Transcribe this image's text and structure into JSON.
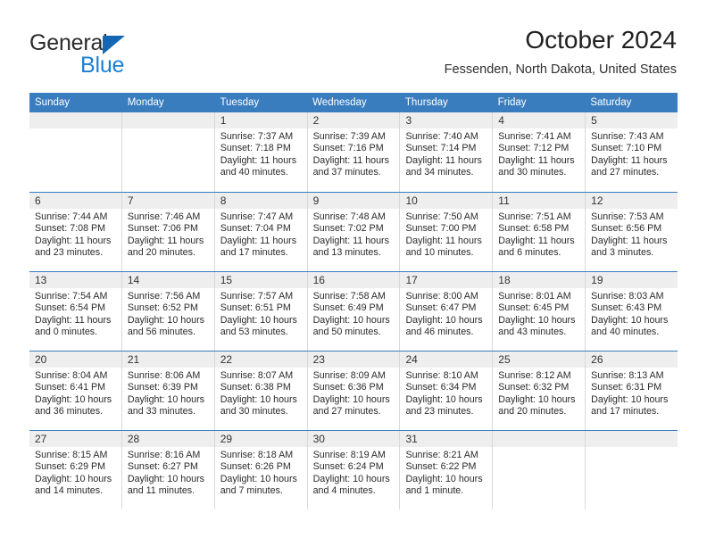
{
  "brand": {
    "name_top": "General",
    "name_bottom": "Blue"
  },
  "header": {
    "title": "October 2024",
    "subtitle": "Fessenden, North Dakota, United States"
  },
  "colors": {
    "header_band": "#3a7dbf",
    "brand_blue": "#1a7fd4",
    "logo_triangle": "#1667b3",
    "date_band": "#eeeeee",
    "cell_border": "#d9d9d9"
  },
  "weekdays": [
    "Sunday",
    "Monday",
    "Tuesday",
    "Wednesday",
    "Thursday",
    "Friday",
    "Saturday"
  ],
  "weeks": [
    [
      {
        "date": "",
        "empty": true
      },
      {
        "date": "",
        "empty": true
      },
      {
        "date": "1",
        "sunrise": "Sunrise: 7:37 AM",
        "sunset": "Sunset: 7:18 PM",
        "daylight": "Daylight: 11 hours and 40 minutes."
      },
      {
        "date": "2",
        "sunrise": "Sunrise: 7:39 AM",
        "sunset": "Sunset: 7:16 PM",
        "daylight": "Daylight: 11 hours and 37 minutes."
      },
      {
        "date": "3",
        "sunrise": "Sunrise: 7:40 AM",
        "sunset": "Sunset: 7:14 PM",
        "daylight": "Daylight: 11 hours and 34 minutes."
      },
      {
        "date": "4",
        "sunrise": "Sunrise: 7:41 AM",
        "sunset": "Sunset: 7:12 PM",
        "daylight": "Daylight: 11 hours and 30 minutes."
      },
      {
        "date": "5",
        "sunrise": "Sunrise: 7:43 AM",
        "sunset": "Sunset: 7:10 PM",
        "daylight": "Daylight: 11 hours and 27 minutes."
      }
    ],
    [
      {
        "date": "6",
        "sunrise": "Sunrise: 7:44 AM",
        "sunset": "Sunset: 7:08 PM",
        "daylight": "Daylight: 11 hours and 23 minutes."
      },
      {
        "date": "7",
        "sunrise": "Sunrise: 7:46 AM",
        "sunset": "Sunset: 7:06 PM",
        "daylight": "Daylight: 11 hours and 20 minutes."
      },
      {
        "date": "8",
        "sunrise": "Sunrise: 7:47 AM",
        "sunset": "Sunset: 7:04 PM",
        "daylight": "Daylight: 11 hours and 17 minutes."
      },
      {
        "date": "9",
        "sunrise": "Sunrise: 7:48 AM",
        "sunset": "Sunset: 7:02 PM",
        "daylight": "Daylight: 11 hours and 13 minutes."
      },
      {
        "date": "10",
        "sunrise": "Sunrise: 7:50 AM",
        "sunset": "Sunset: 7:00 PM",
        "daylight": "Daylight: 11 hours and 10 minutes."
      },
      {
        "date": "11",
        "sunrise": "Sunrise: 7:51 AM",
        "sunset": "Sunset: 6:58 PM",
        "daylight": "Daylight: 11 hours and 6 minutes."
      },
      {
        "date": "12",
        "sunrise": "Sunrise: 7:53 AM",
        "sunset": "Sunset: 6:56 PM",
        "daylight": "Daylight: 11 hours and 3 minutes."
      }
    ],
    [
      {
        "date": "13",
        "sunrise": "Sunrise: 7:54 AM",
        "sunset": "Sunset: 6:54 PM",
        "daylight": "Daylight: 11 hours and 0 minutes."
      },
      {
        "date": "14",
        "sunrise": "Sunrise: 7:56 AM",
        "sunset": "Sunset: 6:52 PM",
        "daylight": "Daylight: 10 hours and 56 minutes."
      },
      {
        "date": "15",
        "sunrise": "Sunrise: 7:57 AM",
        "sunset": "Sunset: 6:51 PM",
        "daylight": "Daylight: 10 hours and 53 minutes."
      },
      {
        "date": "16",
        "sunrise": "Sunrise: 7:58 AM",
        "sunset": "Sunset: 6:49 PM",
        "daylight": "Daylight: 10 hours and 50 minutes."
      },
      {
        "date": "17",
        "sunrise": "Sunrise: 8:00 AM",
        "sunset": "Sunset: 6:47 PM",
        "daylight": "Daylight: 10 hours and 46 minutes."
      },
      {
        "date": "18",
        "sunrise": "Sunrise: 8:01 AM",
        "sunset": "Sunset: 6:45 PM",
        "daylight": "Daylight: 10 hours and 43 minutes."
      },
      {
        "date": "19",
        "sunrise": "Sunrise: 8:03 AM",
        "sunset": "Sunset: 6:43 PM",
        "daylight": "Daylight: 10 hours and 40 minutes."
      }
    ],
    [
      {
        "date": "20",
        "sunrise": "Sunrise: 8:04 AM",
        "sunset": "Sunset: 6:41 PM",
        "daylight": "Daylight: 10 hours and 36 minutes."
      },
      {
        "date": "21",
        "sunrise": "Sunrise: 8:06 AM",
        "sunset": "Sunset: 6:39 PM",
        "daylight": "Daylight: 10 hours and 33 minutes."
      },
      {
        "date": "22",
        "sunrise": "Sunrise: 8:07 AM",
        "sunset": "Sunset: 6:38 PM",
        "daylight": "Daylight: 10 hours and 30 minutes."
      },
      {
        "date": "23",
        "sunrise": "Sunrise: 8:09 AM",
        "sunset": "Sunset: 6:36 PM",
        "daylight": "Daylight: 10 hours and 27 minutes."
      },
      {
        "date": "24",
        "sunrise": "Sunrise: 8:10 AM",
        "sunset": "Sunset: 6:34 PM",
        "daylight": "Daylight: 10 hours and 23 minutes."
      },
      {
        "date": "25",
        "sunrise": "Sunrise: 8:12 AM",
        "sunset": "Sunset: 6:32 PM",
        "daylight": "Daylight: 10 hours and 20 minutes."
      },
      {
        "date": "26",
        "sunrise": "Sunrise: 8:13 AM",
        "sunset": "Sunset: 6:31 PM",
        "daylight": "Daylight: 10 hours and 17 minutes."
      }
    ],
    [
      {
        "date": "27",
        "sunrise": "Sunrise: 8:15 AM",
        "sunset": "Sunset: 6:29 PM",
        "daylight": "Daylight: 10 hours and 14 minutes."
      },
      {
        "date": "28",
        "sunrise": "Sunrise: 8:16 AM",
        "sunset": "Sunset: 6:27 PM",
        "daylight": "Daylight: 10 hours and 11 minutes."
      },
      {
        "date": "29",
        "sunrise": "Sunrise: 8:18 AM",
        "sunset": "Sunset: 6:26 PM",
        "daylight": "Daylight: 10 hours and 7 minutes."
      },
      {
        "date": "30",
        "sunrise": "Sunrise: 8:19 AM",
        "sunset": "Sunset: 6:24 PM",
        "daylight": "Daylight: 10 hours and 4 minutes."
      },
      {
        "date": "31",
        "sunrise": "Sunrise: 8:21 AM",
        "sunset": "Sunset: 6:22 PM",
        "daylight": "Daylight: 10 hours and 1 minute."
      },
      {
        "date": "",
        "empty": true
      },
      {
        "date": "",
        "empty": true
      }
    ]
  ]
}
